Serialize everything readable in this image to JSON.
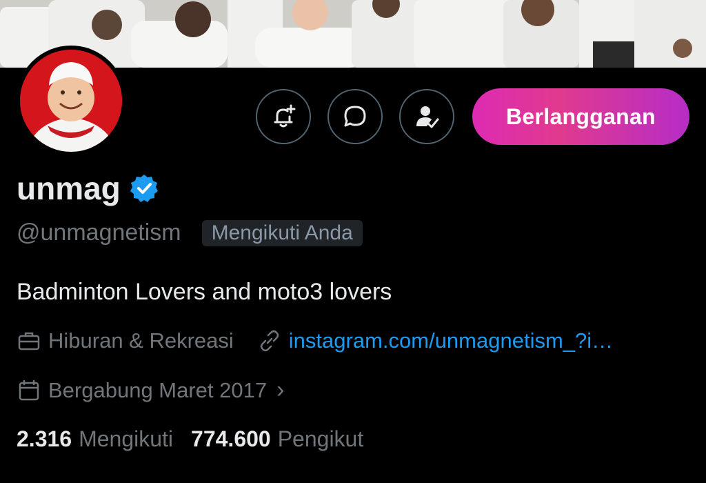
{
  "profile": {
    "display_name": "unmag",
    "handle": "@unmagnetism",
    "follows_you_badge": "Mengikuti Anda",
    "bio": "Badminton Lovers and moto3 lovers",
    "category": "Hiburan & Rekreasi",
    "website": "instagram.com/unmagnetism_?i…",
    "joined": "Bergabung Maret 2017",
    "joined_chevron": "›"
  },
  "actions": {
    "notify_icon": "bell-plus-icon",
    "message_icon": "message-bubble-icon",
    "following_icon": "person-check-icon",
    "subscribe_label": "Berlangganan"
  },
  "stats": {
    "following_count": "2.316",
    "following_label": "Mengikuti",
    "followers_count": "774.600",
    "followers_label": "Pengikut"
  },
  "colors": {
    "background": "#000000",
    "verified": "#1d9bf0",
    "link": "#1d9bf0",
    "subscribe_gradient_start": "#dd2bb4",
    "subscribe_gradient_end": "#b62dc6",
    "muted_text": "#71767b"
  }
}
